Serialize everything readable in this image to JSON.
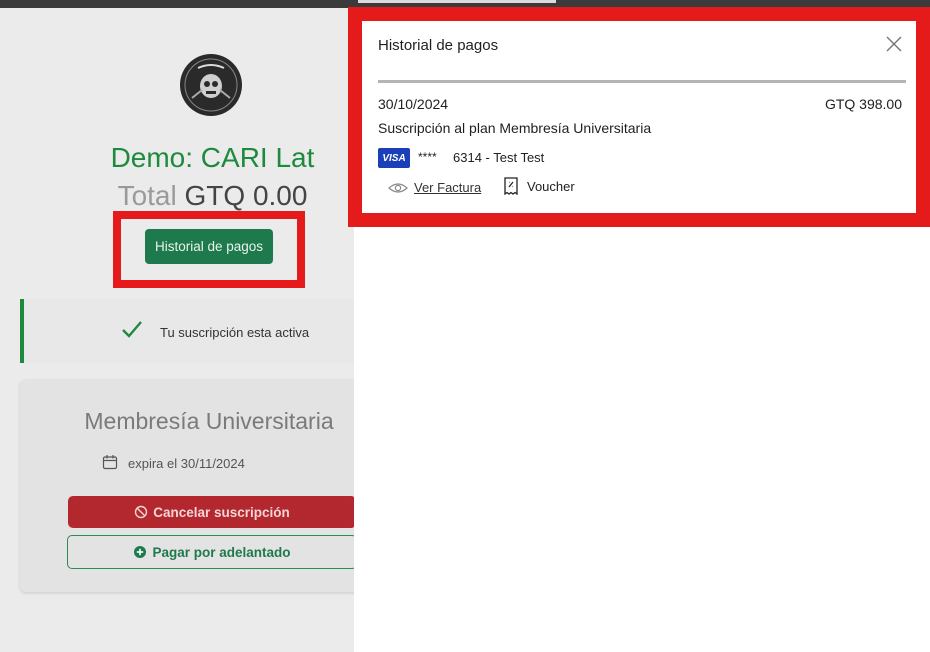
{
  "background": {
    "store_title": "Demo: CARI Lat",
    "total_label": "Total",
    "total_value": "GTQ 0.00",
    "history_button": "Historial de pagos",
    "status_text": "Tu suscripción esta activa",
    "plan": {
      "name": "Membresía Universitaria",
      "expiry": "expira el 30/11/2024",
      "cancel_button": "Cancelar suscripción",
      "pay_ahead_button": "Pagar por adelantado"
    }
  },
  "drawer": {
    "title": "Historial de pagos",
    "payments": [
      {
        "date": "30/10/2024",
        "amount": "GTQ 398.00",
        "description": "Suscripción al plan Membresía Universitaria",
        "card_brand": "VISA",
        "card_mask": "****",
        "card_holder": "6314 - Test Test",
        "view_invoice": "Ver Factura",
        "voucher": "Voucher"
      }
    ]
  },
  "colors": {
    "brand_green": "#1e8a3e",
    "button_green": "#1e7a4c",
    "cancel_red": "#b3282e",
    "highlight_red": "#e51b1b",
    "visa_blue": "#1a3fb8"
  },
  "icons": [
    "bikers-logo",
    "check-icon",
    "calendar-icon",
    "ban-icon",
    "plus-circle-icon",
    "close-icon",
    "eye-icon",
    "receipt-icon",
    "visa-icon"
  ]
}
